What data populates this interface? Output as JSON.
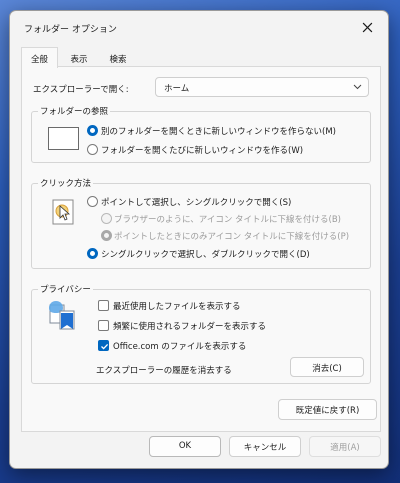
{
  "window": {
    "title": "フォルダー オプション"
  },
  "tabs": [
    {
      "label": "全般",
      "active": true
    },
    {
      "label": "表示",
      "active": false
    },
    {
      "label": "検索",
      "active": false
    }
  ],
  "general": {
    "open_label": "エクスプローラーで開く:",
    "open_value": "ホーム",
    "browse_folders": {
      "legend": "フォルダーの参照",
      "options": [
        {
          "label": "別のフォルダーを開くときに新しいウィンドウを作らない(M)",
          "checked": true
        },
        {
          "label": "フォルダーを開くたびに新しいウィンドウを作る(W)",
          "checked": false
        }
      ]
    },
    "click_method": {
      "legend": "クリック方法",
      "options": [
        {
          "label": "ポイントして選択し、シングルクリックで開く(S)",
          "checked": false,
          "disabled": false
        },
        {
          "label": "ブラウザーのように、アイコン タイトルに下線を付ける(B)",
          "checked": false,
          "disabled": true
        },
        {
          "label": "ポイントしたときにのみアイコン タイトルに下線を付ける(P)",
          "checked": true,
          "disabled": true
        },
        {
          "label": "シングルクリックで選択し、ダブルクリックで開く(D)",
          "checked": true,
          "disabled": false
        }
      ]
    },
    "privacy": {
      "legend": "プライバシー",
      "checkboxes": [
        {
          "label": "最近使用したファイルを表示する",
          "checked": false
        },
        {
          "label": "頻繁に使用されるフォルダーを表示する",
          "checked": false
        },
        {
          "label": "Office.com のファイルを表示する",
          "checked": true
        }
      ],
      "clear_label": "エクスプローラーの履歴を消去する",
      "clear_button": "消去(C)"
    },
    "restore_button": "既定値に戻す(R)"
  },
  "footer": {
    "ok": "OK",
    "cancel": "キャンセル",
    "apply": "適用(A)"
  },
  "colors": {
    "accent": "#0067c0"
  }
}
